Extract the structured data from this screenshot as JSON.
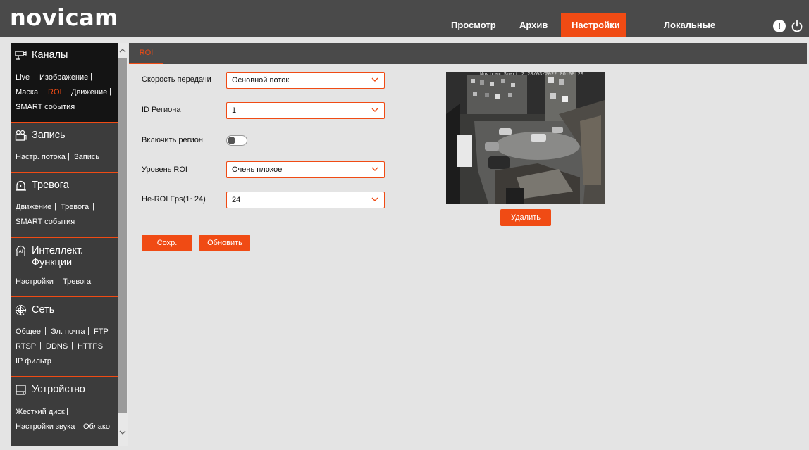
{
  "header": {
    "logo": "novicam",
    "nav": [
      "Просмотр",
      "Архив",
      "Настройки",
      "Локальные настройки"
    ],
    "active_nav": "Настройки",
    "icons": [
      "info-icon",
      "power-icon"
    ]
  },
  "sidebar": {
    "sections": [
      {
        "title": "Каналы",
        "icon": "camera-icon",
        "links": [
          "Live",
          "Изображение",
          "Маска",
          "ROI",
          "Движение",
          "SMART события"
        ],
        "active": "ROI"
      },
      {
        "title": "Запись",
        "icon": "video-icon",
        "links": [
          "Настр. потока",
          "Запись"
        ]
      },
      {
        "title": "Тревога",
        "icon": "alarm-icon",
        "links": [
          "Движение",
          "Тревога",
          "SMART события"
        ]
      },
      {
        "title": "Интеллект. Функции",
        "title_line1": "Интеллект.",
        "title_line2": "Функции",
        "icon": "ai-icon",
        "links": [
          "Настройки",
          "Тревога"
        ]
      },
      {
        "title": "Сеть",
        "icon": "network-icon",
        "links": [
          "Общее",
          "Эл. почта",
          "FTP",
          "RTSP",
          "DDNS",
          "HTTPS",
          "IP фильтр"
        ]
      },
      {
        "title": "Устройство",
        "icon": "hdd-icon",
        "links": [
          "Жесткий диск",
          "Настройки звука",
          "Облако"
        ]
      }
    ]
  },
  "content": {
    "tab": "ROI",
    "form": {
      "stream": {
        "label": "Скорость передачи",
        "value": "Основной поток"
      },
      "region_id": {
        "label": "ID Региона",
        "value": "1"
      },
      "enable_region": {
        "label": "Включить регион",
        "enabled": false
      },
      "roi_level": {
        "label": "Уровень ROI",
        "value": "Очень плохое"
      },
      "non_roi_fps": {
        "label": "Не-ROI Fps(1~24)",
        "value": "24"
      }
    },
    "buttons": {
      "save": "Сохр.",
      "refresh": "Обновить",
      "delete": "Удалить"
    },
    "preview": {
      "osd": "Novicam Smart 2  28/03/2022 00:08:29"
    }
  },
  "colors": {
    "accent": "#f04b14",
    "header_bg": "#4a4a4a",
    "sidebar_bg": "#3c3c3c",
    "content_bg": "#e4e4e4"
  }
}
